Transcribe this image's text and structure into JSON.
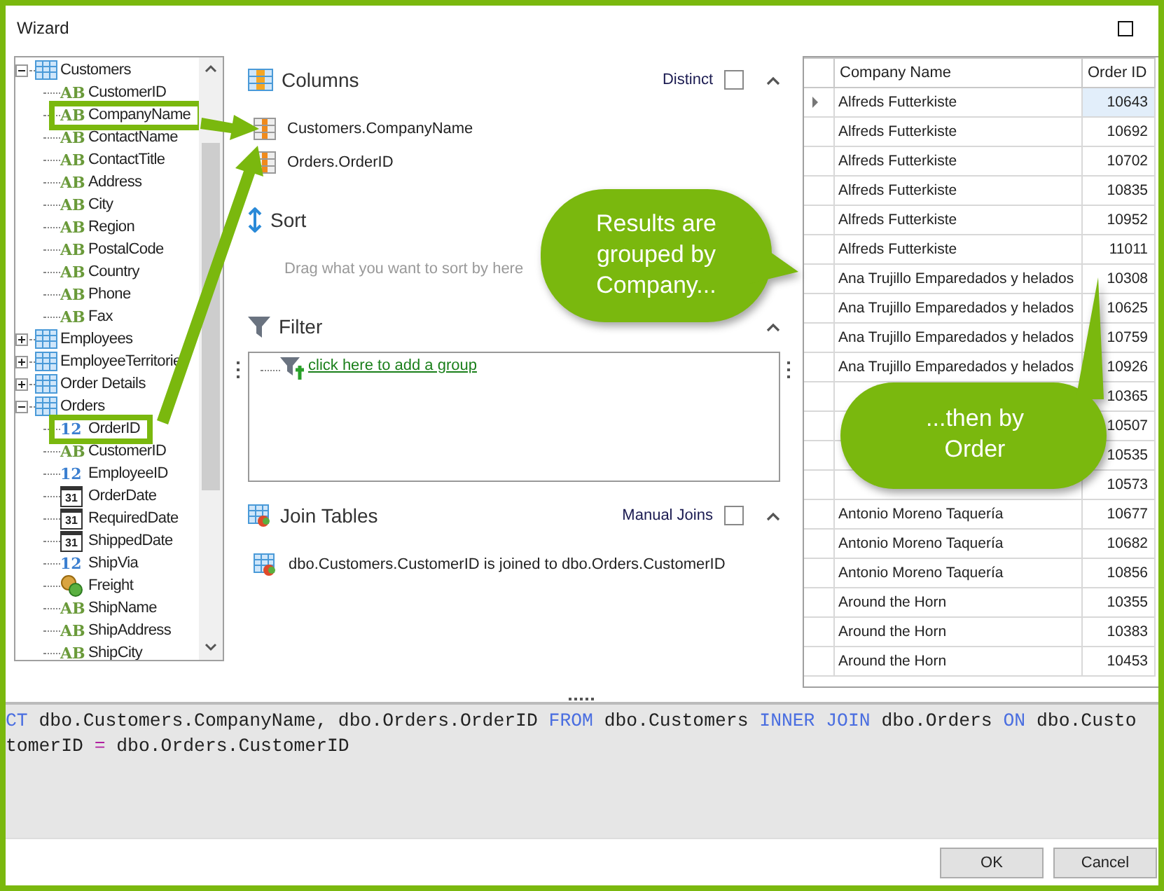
{
  "window": {
    "title": "Wizard"
  },
  "tree": [
    {
      "kind": "table",
      "label": "Customers",
      "expanded": true,
      "children": [
        {
          "kind": "text",
          "glyph": "AB",
          "label": "CustomerID",
          "highlighted": false
        },
        {
          "kind": "text",
          "glyph": "AB",
          "label": "CompanyName",
          "highlighted": true
        },
        {
          "kind": "text",
          "glyph": "AB",
          "label": "ContactName",
          "highlighted": false
        },
        {
          "kind": "text",
          "glyph": "AB",
          "label": "ContactTitle",
          "highlighted": false
        },
        {
          "kind": "text",
          "glyph": "AB",
          "label": "Address",
          "highlighted": false
        },
        {
          "kind": "text",
          "glyph": "AB",
          "label": "City",
          "highlighted": false
        },
        {
          "kind": "text",
          "glyph": "AB",
          "label": "Region",
          "highlighted": false
        },
        {
          "kind": "text",
          "glyph": "AB",
          "label": "PostalCode",
          "highlighted": false
        },
        {
          "kind": "text",
          "glyph": "AB",
          "label": "Country",
          "highlighted": false
        },
        {
          "kind": "text",
          "glyph": "AB",
          "label": "Phone",
          "highlighted": false
        },
        {
          "kind": "text",
          "glyph": "AB",
          "label": "Fax",
          "highlighted": false
        }
      ]
    },
    {
      "kind": "table",
      "label": "Employees",
      "expanded": false
    },
    {
      "kind": "table",
      "label": "EmployeeTerritorie",
      "expanded": false
    },
    {
      "kind": "table",
      "label": "Order Details",
      "expanded": false
    },
    {
      "kind": "table",
      "label": "Orders",
      "expanded": true,
      "children": [
        {
          "kind": "number",
          "glyph": "12",
          "label": "OrderID",
          "highlighted": true
        },
        {
          "kind": "text",
          "glyph": "AB",
          "label": "CustomerID",
          "highlighted": false
        },
        {
          "kind": "number",
          "glyph": "12",
          "label": "EmployeeID",
          "highlighted": false
        },
        {
          "kind": "date",
          "glyph": "31",
          "label": "OrderDate",
          "highlighted": false
        },
        {
          "kind": "date",
          "glyph": "31",
          "label": "RequiredDate",
          "highlighted": false
        },
        {
          "kind": "date",
          "glyph": "31",
          "label": "ShippedDate",
          "highlighted": false
        },
        {
          "kind": "number",
          "glyph": "12",
          "label": "ShipVia",
          "highlighted": false
        },
        {
          "kind": "money",
          "label": "Freight",
          "highlighted": false
        },
        {
          "kind": "text",
          "glyph": "AB",
          "label": "ShipName",
          "highlighted": false
        },
        {
          "kind": "text",
          "glyph": "AB",
          "label": "ShipAddress",
          "highlighted": false
        },
        {
          "kind": "text",
          "glyph": "AB",
          "label": "ShipCity",
          "highlighted": false
        }
      ]
    }
  ],
  "sections": [
    {
      "kind": "columns",
      "title": "Columns",
      "expanded": true,
      "option": {
        "label": "Distinct",
        "checked": false
      },
      "items": [
        "Customers.CompanyName",
        "Orders.OrderID"
      ]
    },
    {
      "kind": "sort",
      "title": "Sort",
      "hint": "Drag what you want to sort by here"
    },
    {
      "kind": "filter",
      "title": "Filter",
      "expanded": true,
      "link": "click here to add a group"
    },
    {
      "kind": "joins",
      "title": "Join Tables",
      "expanded": true,
      "option": {
        "label": "Manual Joins",
        "checked": false
      },
      "items": [
        "dbo.Customers.CustomerID is joined to dbo.Orders.CustomerID"
      ]
    }
  ],
  "grid": {
    "columns": [
      "Company Name",
      "Order ID"
    ],
    "rows": [
      {
        "company": "Alfreds Futterkiste",
        "order_id": "10643",
        "selected": true
      },
      {
        "company": "Alfreds Futterkiste",
        "order_id": "10692",
        "selected": false
      },
      {
        "company": "Alfreds Futterkiste",
        "order_id": "10702",
        "selected": false
      },
      {
        "company": "Alfreds Futterkiste",
        "order_id": "10835",
        "selected": false
      },
      {
        "company": "Alfreds Futterkiste",
        "order_id": "10952",
        "selected": false
      },
      {
        "company": "Alfreds Futterkiste",
        "order_id": "11011",
        "selected": false
      },
      {
        "company": "Ana Trujillo Emparedados y helados",
        "order_id": "10308",
        "selected": false
      },
      {
        "company": "Ana Trujillo Emparedados y helados",
        "order_id": "10625",
        "selected": false
      },
      {
        "company": "Ana Trujillo Emparedados y helados",
        "order_id": "10759",
        "selected": false
      },
      {
        "company": "Ana Trujillo Emparedados y helados",
        "order_id": "10926",
        "selected": false
      },
      {
        "order_id": "10365",
        "selected": false
      },
      {
        "order_id": "10507",
        "selected": false
      },
      {
        "order_id": "10535",
        "selected": false
      },
      {
        "order_id": "10573",
        "selected": false
      },
      {
        "company": "Antonio Moreno Taquería",
        "order_id": "10677",
        "selected": false
      },
      {
        "company": "Antonio Moreno Taquería",
        "order_id": "10682",
        "selected": false
      },
      {
        "company": "Antonio Moreno Taquería",
        "order_id": "10856",
        "selected": false
      },
      {
        "company": "Around the Horn",
        "order_id": "10355",
        "selected": false
      },
      {
        "company": "Around the Horn",
        "order_id": "10383",
        "selected": false
      },
      {
        "company": "Around the Horn",
        "order_id": "10453",
        "selected": false
      }
    ]
  },
  "sql": [
    [
      {
        "kind": "keyword",
        "text": "CT"
      },
      {
        "kind": "plain",
        "text": " dbo.Customers.CompanyName, dbo.Orders.OrderID "
      },
      {
        "kind": "keyword",
        "text": "FROM"
      },
      {
        "kind": "plain",
        "text": " dbo.Customers "
      },
      {
        "kind": "keyword",
        "text": "INNER JOIN"
      },
      {
        "kind": "plain",
        "text": " dbo.Orders "
      },
      {
        "kind": "keyword",
        "text": "ON"
      },
      {
        "kind": "plain",
        "text": " dbo.Custo"
      }
    ],
    [
      {
        "kind": "plain",
        "text": "tomerID "
      },
      {
        "kind": "operator",
        "text": "="
      },
      {
        "kind": "plain",
        "text": " dbo.Orders.CustomerID"
      }
    ]
  ],
  "buttons": [
    "OK",
    "Cancel"
  ],
  "callouts": [
    {
      "text": "Results are grouped by Company..."
    },
    {
      "text": "...then by Order"
    }
  ]
}
